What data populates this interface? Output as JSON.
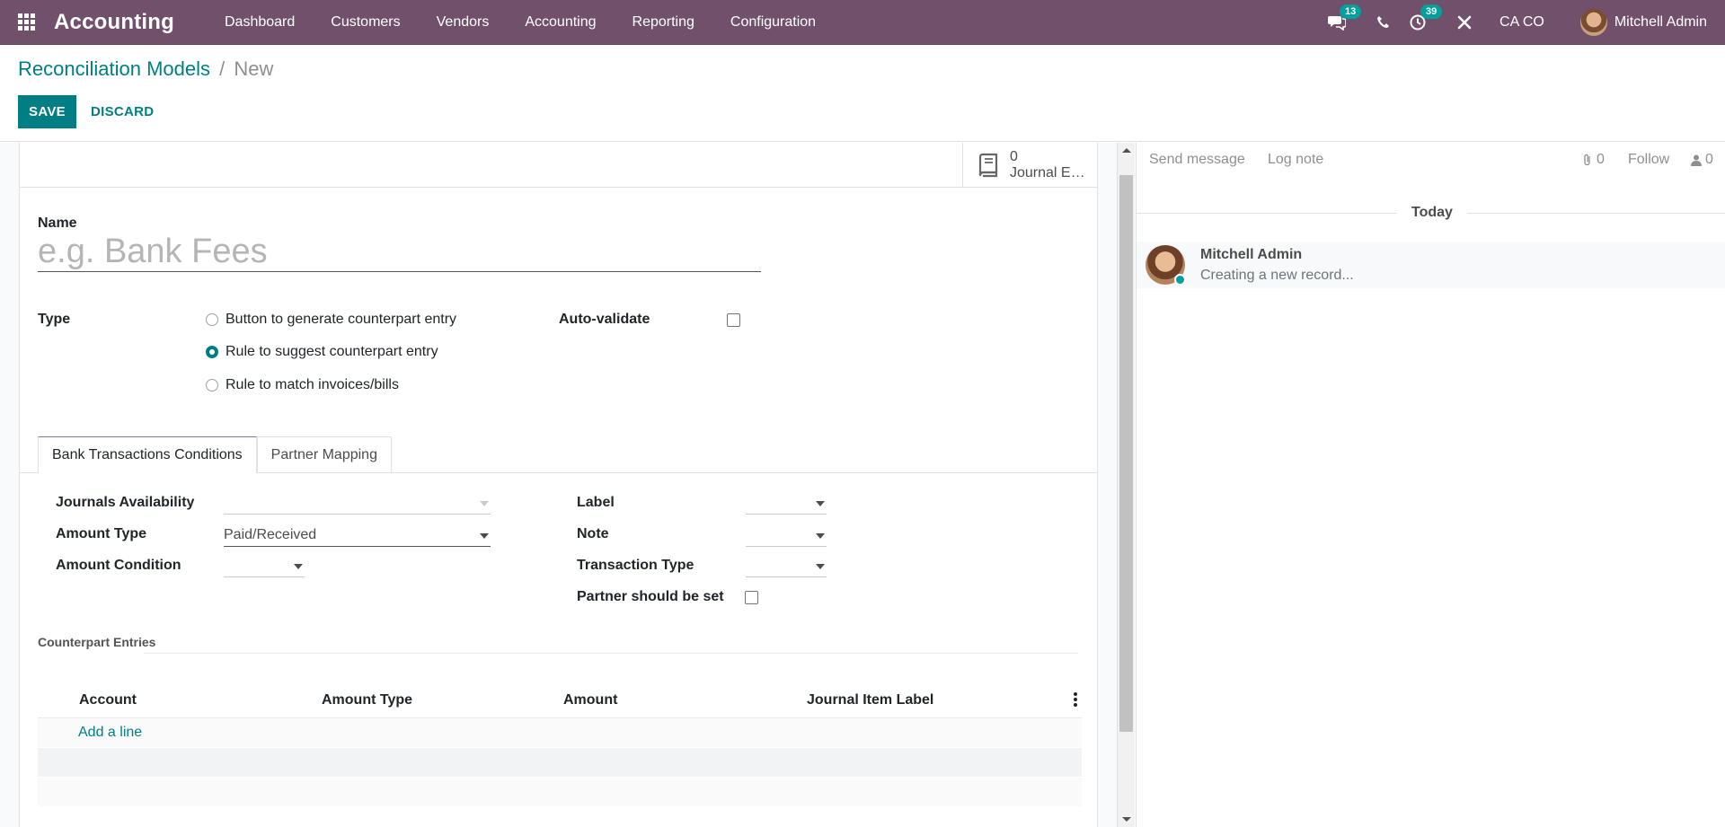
{
  "navbar": {
    "brand": "Accounting",
    "menu": [
      "Dashboard",
      "Customers",
      "Vendors",
      "Accounting",
      "Reporting",
      "Configuration"
    ],
    "messages_count": "13",
    "activities_count": "39",
    "company": "CA CO",
    "user_name": "Mitchell Admin"
  },
  "breadcrumb": {
    "parent": "Reconciliation Models",
    "separator": "/",
    "current": "New"
  },
  "actions": {
    "save": "SAVE",
    "discard": "DISCARD"
  },
  "stat_button": {
    "value": "0",
    "label": "Journal Entries"
  },
  "form": {
    "name_label": "Name",
    "name_placeholder": "e.g. Bank Fees",
    "type_label": "Type",
    "type_options": [
      {
        "label": "Button to generate counterpart entry",
        "checked": false
      },
      {
        "label": "Rule to suggest counterpart entry",
        "checked": true
      },
      {
        "label": "Rule to match invoices/bills",
        "checked": false
      }
    ],
    "auto_validate_label": "Auto-validate"
  },
  "tabs": [
    "Bank Transactions Conditions",
    "Partner Mapping"
  ],
  "conditions": {
    "journals_availability_label": "Journals Availability",
    "journals_availability_value": "",
    "amount_type_label": "Amount Type",
    "amount_type_value": "Paid/Received",
    "amount_condition_label": "Amount Condition",
    "amount_condition_value": "",
    "label_label": "Label",
    "note_label": "Note",
    "transaction_type_label": "Transaction Type",
    "partner_set_label": "Partner should be set"
  },
  "counterpart": {
    "section_title": "Counterpart Entries",
    "columns": [
      "Account",
      "Amount Type",
      "Amount",
      "Journal Item Label"
    ],
    "add_line": "Add a line"
  },
  "chatter": {
    "send_message": "Send message",
    "log_note": "Log note",
    "attachments_count": "0",
    "follow": "Follow",
    "followers_count": "0",
    "today": "Today",
    "message_author": "Mitchell Admin",
    "message_body": "Creating a new record..."
  },
  "colors": {
    "navbar": "#71506b",
    "primary": "#017e84",
    "badge": "#00a09d"
  }
}
